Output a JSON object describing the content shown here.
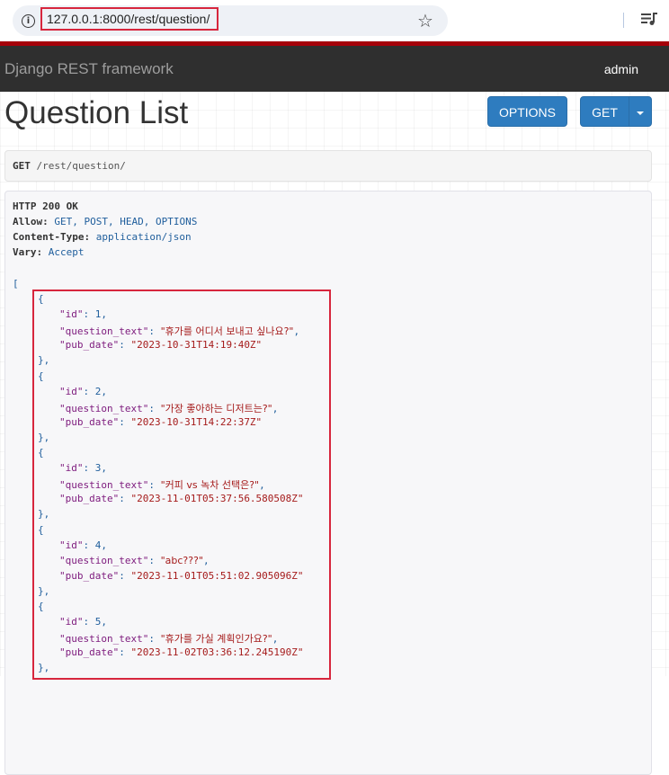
{
  "browser": {
    "url": "127.0.0.1:8000/rest/question/",
    "star_icon": "star-icon",
    "queue_icon": "playlist-icon"
  },
  "navbar": {
    "brand": "Django REST framework",
    "user": "admin"
  },
  "page": {
    "title": "Question List",
    "options_label": "OPTIONS",
    "get_label": "GET"
  },
  "request": {
    "method": "GET",
    "path": "/rest/question/"
  },
  "response": {
    "status": "HTTP 200 OK",
    "headers": [
      {
        "key": "Allow:",
        "value": "GET, POST, HEAD, OPTIONS"
      },
      {
        "key": "Content-Type:",
        "value": "application/json"
      },
      {
        "key": "Vary:",
        "value": "Accept"
      }
    ],
    "items": [
      {
        "id": "1",
        "question_text": "\"휴가를 어디서 보내고 싶나요?\"",
        "pub_date": "\"2023-10-31T14:19:40Z\""
      },
      {
        "id": "2",
        "question_text": "\"가장 좋아하는 디저트는?\"",
        "pub_date": "\"2023-10-31T14:22:37Z\""
      },
      {
        "id": "3",
        "question_text": "\"커피 vs 녹차 선택은?\"",
        "pub_date": "\"2023-11-01T05:37:56.580508Z\""
      },
      {
        "id": "4",
        "question_text": "\"abc???\"",
        "pub_date": "\"2023-11-01T05:51:02.905096Z\""
      },
      {
        "id": "5",
        "question_text": "\"휴가를 가실 계획인가요?\"",
        "pub_date": "\"2023-11-02T03:36:12.245190Z\""
      }
    ],
    "keys": {
      "id": "\"id\"",
      "question_text": "\"question_text\"",
      "pub_date": "\"pub_date\""
    }
  },
  "colors": {
    "navbar_bg": "#2f2f2f",
    "accent_red": "#a5000a",
    "button_blue": "#2e7cbf",
    "highlight_red": "#d7263d"
  }
}
